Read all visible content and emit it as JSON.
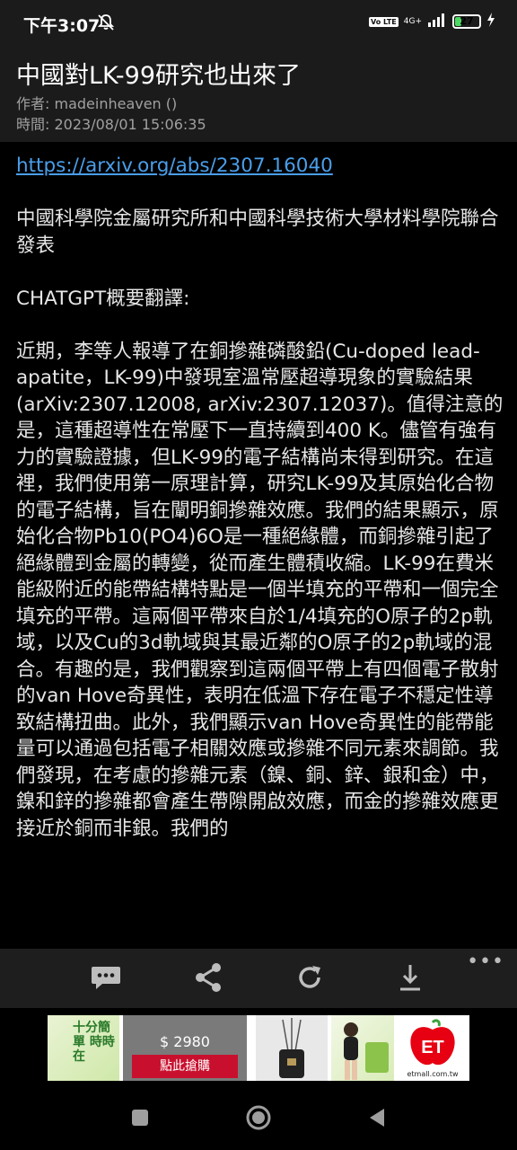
{
  "status_bar": {
    "time": "下午3:07",
    "volte": "Vo LTE",
    "network": "4G+",
    "battery": "27",
    "battery_level": 0.27
  },
  "post": {
    "title": "中國對LK-99研究也出來了",
    "author": "作者: madeinheaven ()",
    "time": "時間: 2023/08/01 15:06:35"
  },
  "content": {
    "link": "https://arxiv.org/abs/2307.16040",
    "paragraph1": "中國科學院金屬研究所和中國科學技術大學材料學院聯合發表",
    "paragraph2": "CHATGPT概要翻譯:",
    "paragraph3": "近期，李等人報導了在銅摻雜磷酸鉛(Cu-doped lead-apatite，LK-99)中發現室溫常壓超導現象的實驗結果(arXiv:2307.12008, arXiv:2307.12037)。值得注意的是，這種超導性在常壓下一直持續到400 K。儘管有強有力的實驗證據，但LK-99的電子結構尚未得到研究。在這裡，我們使用第一原理計算，研究LK-99及其原始化合物的電子結構，旨在闡明銅摻雜效應。我們的結果顯示，原始化合物Pb10(PO4)6O是一種絕緣體，而銅摻雜引起了絕緣體到金屬的轉變，從而產生體積收縮。LK-99在費米能級附近的能帶結構特點是一個半填充的平帶和一個完全填充的平帶。這兩個平帶來自於1/4填充的O原子的2p軌域，以及Cu的3d軌域與其最近鄰的O原子的2p軌域的混合。有趣的是，我們觀察到這兩個平帶上有四個電子散射的van Hove奇異性，表明在低溫下存在電子不穩定性導致結構扭曲。此外，我們顯示van Hove奇異性的能帶能量可以通過包括電子相關效應或摻雜不同元素來調節。我們發現，在考慮的摻雜元素（鎳、銅、鋅、銀和金）中，鎳和鋅的摻雜都會產生帶隙開啟效應，而金的摻雜效應更接近於銅而非銀。我們的"
  },
  "toolbar": {
    "icons": [
      "comment-icon",
      "share-icon",
      "refresh-icon",
      "download-icon",
      "more-icon"
    ],
    "more": "•••"
  },
  "ad": {
    "banner_text": "十分簡單 時時在",
    "price": "$ 2980",
    "cta": "點此搶購",
    "logo_text": "ET",
    "logo_url_text": "etmall.com.tw",
    "brand_color": "#e60012"
  },
  "nav_bar": {
    "icons": [
      "recents-icon",
      "home-icon",
      "back-icon"
    ]
  }
}
